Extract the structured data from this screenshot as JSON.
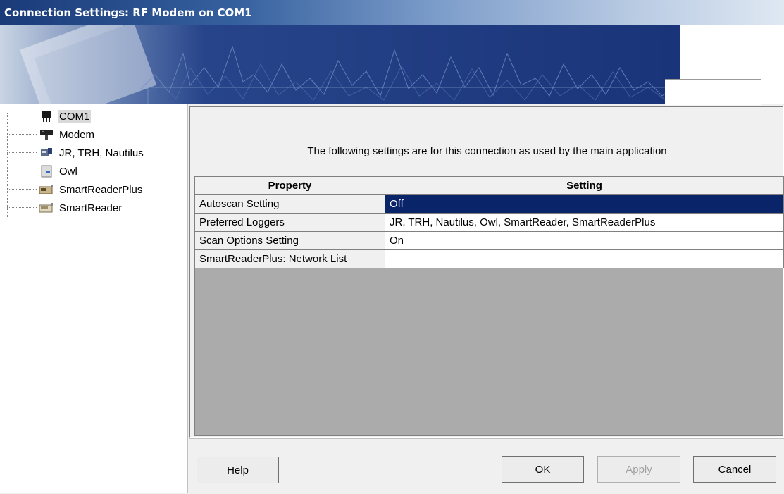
{
  "window": {
    "title": "Connection Settings: RF Modem on COM1"
  },
  "tree": {
    "items": [
      {
        "label": "COM1",
        "icon": "serial-port-icon",
        "selected": true
      },
      {
        "label": "Modem",
        "icon": "modem-icon"
      },
      {
        "label": "JR, TRH, Nautilus",
        "icon": "logger-device-icon"
      },
      {
        "label": "Owl",
        "icon": "owl-device-icon"
      },
      {
        "label": "SmartReaderPlus",
        "icon": "smartreaderplus-icon"
      },
      {
        "label": "SmartReader",
        "icon": "smartreader-icon"
      }
    ]
  },
  "main": {
    "description": "The following settings are for this connection as used by the main application",
    "grid": {
      "columns": [
        "Property",
        "Setting"
      ],
      "rows": [
        {
          "property": "Autoscan Setting",
          "setting": "Off",
          "selected": true
        },
        {
          "property": "Preferred Loggers",
          "setting": "JR, TRH, Nautilus, Owl, SmartReader, SmartReaderPlus"
        },
        {
          "property": "Scan Options Setting",
          "setting": "On"
        },
        {
          "property": "SmartReaderPlus: Network List",
          "setting": ""
        }
      ]
    }
  },
  "buttons": {
    "help": "Help",
    "ok": "OK",
    "apply": "Apply",
    "cancel": "Cancel"
  }
}
